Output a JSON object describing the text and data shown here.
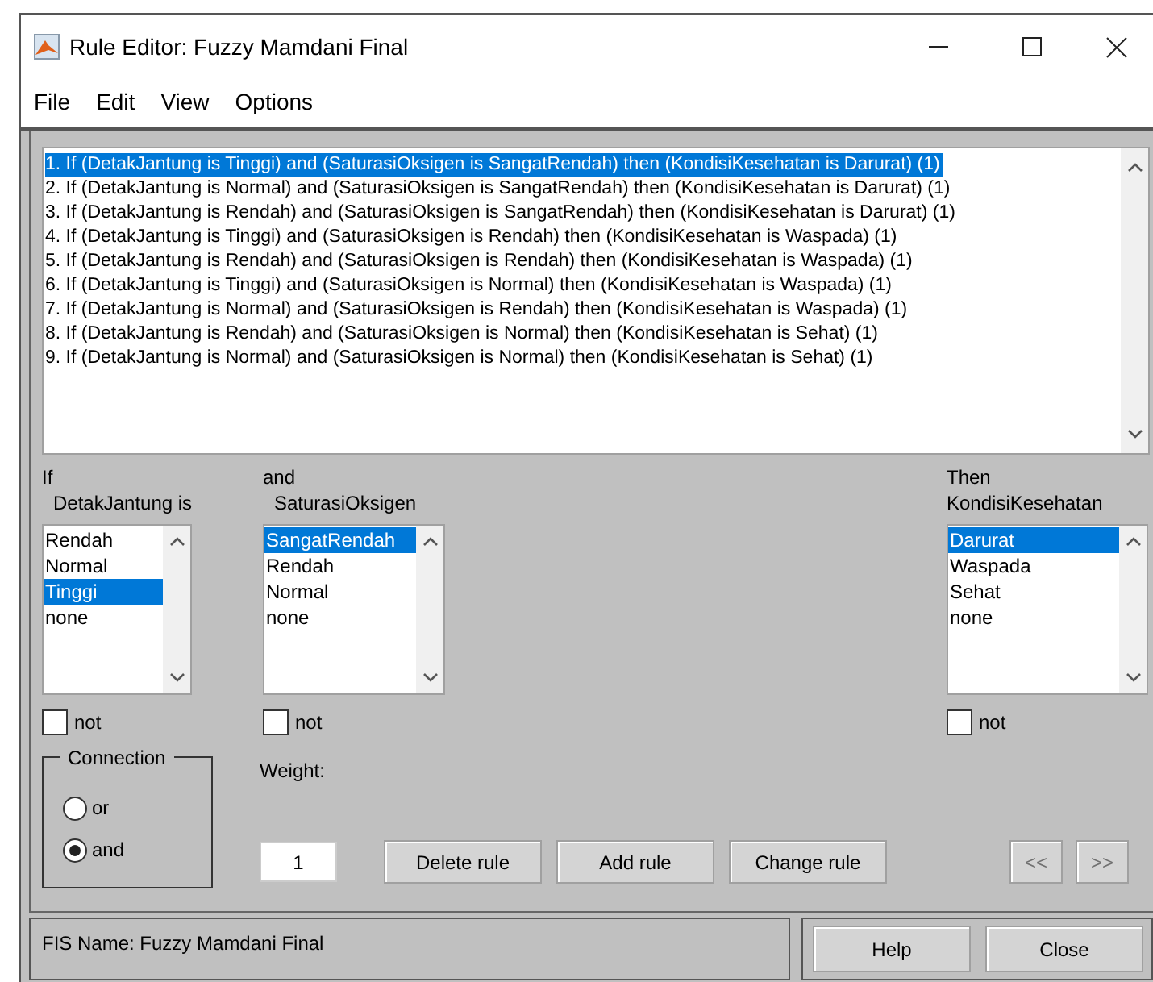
{
  "window": {
    "title": "Rule Editor: Fuzzy Mamdani Final"
  },
  "menu": [
    "File",
    "Edit",
    "View",
    "Options"
  ],
  "rules": [
    {
      "text": "1. If (DetakJantung is Tinggi) and (SaturasiOksigen is SangatRendah) then (KondisiKesehatan is Darurat) (1)",
      "selected": true
    },
    {
      "text": "2. If (DetakJantung is Normal) and (SaturasiOksigen is SangatRendah) then (KondisiKesehatan is Darurat) (1)",
      "selected": false
    },
    {
      "text": "3. If (DetakJantung is Rendah) and (SaturasiOksigen is SangatRendah) then (KondisiKesehatan is Darurat) (1)",
      "selected": false
    },
    {
      "text": "4. If (DetakJantung is Tinggi) and (SaturasiOksigen is Rendah) then (KondisiKesehatan is Waspada) (1)",
      "selected": false
    },
    {
      "text": "5. If (DetakJantung is Rendah) and (SaturasiOksigen is Rendah) then (KondisiKesehatan is Waspada) (1)",
      "selected": false
    },
    {
      "text": "6. If (DetakJantung is Tinggi) and (SaturasiOksigen is Normal) then (KondisiKesehatan is Waspada) (1)",
      "selected": false
    },
    {
      "text": "7. If (DetakJantung is Normal) and (SaturasiOksigen is Rendah) then (KondisiKesehatan is Waspada) (1)",
      "selected": false
    },
    {
      "text": "8. If (DetakJantung is Rendah) and (SaturasiOksigen is Normal) then (KondisiKesehatan is Sehat) (1)",
      "selected": false
    },
    {
      "text": "9. If (DetakJantung is Normal) and (SaturasiOksigen is Normal) then (KondisiKesehatan is Sehat) (1)",
      "selected": false
    }
  ],
  "variables": [
    {
      "kind": "input",
      "keyword": "If",
      "name": "DetakJantung is",
      "options": [
        {
          "label": "Rendah",
          "selected": false
        },
        {
          "label": "Normal",
          "selected": false
        },
        {
          "label": "Tinggi",
          "selected": true
        },
        {
          "label": "none",
          "selected": false
        }
      ],
      "not": {
        "label": "not",
        "checked": false
      }
    },
    {
      "kind": "input",
      "keyword": "and",
      "name": "SaturasiOksigen",
      "options": [
        {
          "label": "SangatRendah",
          "selected": true
        },
        {
          "label": "Rendah",
          "selected": false
        },
        {
          "label": "Normal",
          "selected": false
        },
        {
          "label": "none",
          "selected": false
        }
      ],
      "not": {
        "label": "not",
        "checked": false
      }
    },
    {
      "kind": "output",
      "keyword": "Then",
      "name": "KondisiKesehatan",
      "options": [
        {
          "label": "Darurat",
          "selected": true
        },
        {
          "label": "Waspada",
          "selected": false
        },
        {
          "label": "Sehat",
          "selected": false
        },
        {
          "label": "none",
          "selected": false
        }
      ],
      "not": {
        "label": "not",
        "checked": false
      }
    }
  ],
  "connection": {
    "title": "Connection",
    "options": [
      {
        "label": "or",
        "selected": false
      },
      {
        "label": "and",
        "selected": true
      }
    ]
  },
  "weight": {
    "label": "Weight:",
    "value": "1"
  },
  "rule_buttons": [
    {
      "label": "Delete rule",
      "disabled": false
    },
    {
      "label": "Add rule",
      "disabled": false
    },
    {
      "label": "Change rule",
      "disabled": false
    }
  ],
  "nav_buttons": [
    {
      "label": "<<",
      "disabled": true
    },
    {
      "label": ">>",
      "disabled": true
    }
  ],
  "status": "FIS Name: Fuzzy Mamdani Final",
  "footer_buttons": [
    "Help",
    "Close"
  ]
}
